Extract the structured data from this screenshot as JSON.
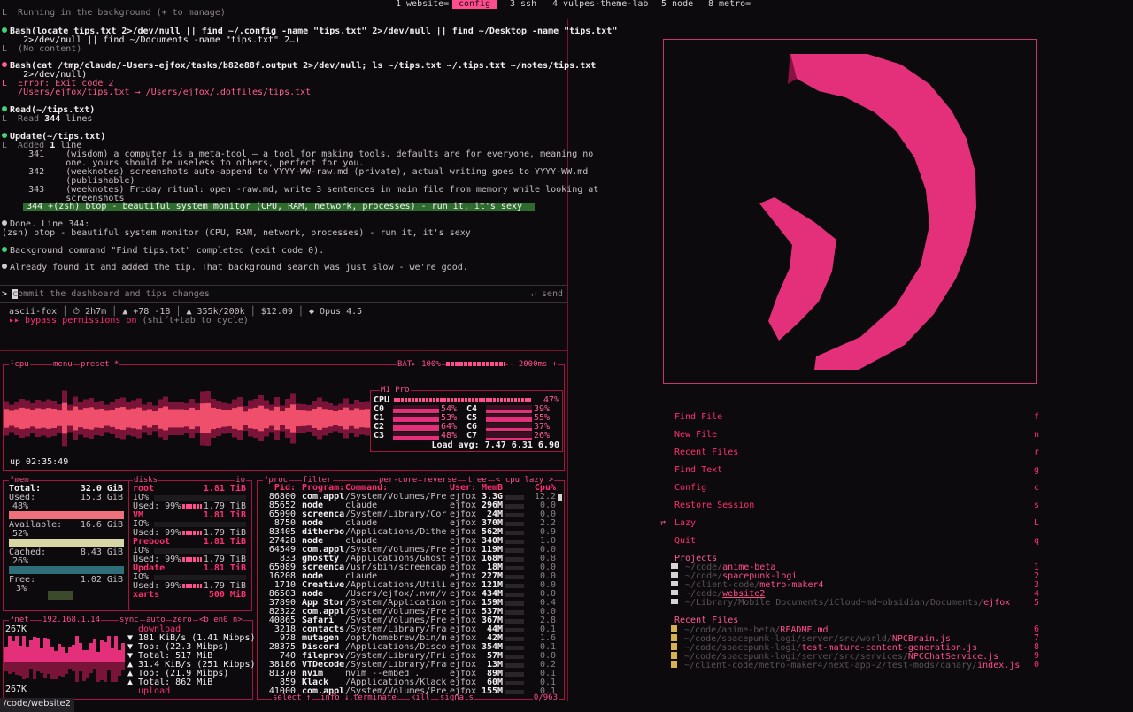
{
  "tabs": [
    {
      "label": "1 website=",
      "active": false
    },
    {
      "label": "config",
      "active": true
    },
    {
      "label": "3 ssh",
      "active": false
    },
    {
      "label": "4 vulpes-theme-lab",
      "active": false
    },
    {
      "label": "5 node",
      "active": false
    },
    {
      "label": "8 metro=",
      "active": false
    }
  ],
  "claude": {
    "running_bg": "L  Running in the background (+ to manage)",
    "bash1_l1": "Bash(locate tips.txt 2>/dev/null || find ~/.config -name \"tips.txt\" 2>/dev/null || find ~/Desktop -name \"tips.txt\"",
    "bash1_l2": "    2>/dev/null || find ~/Documents -name \"tips.txt\" 2…)",
    "bash1_out": "L  (No content)",
    "bash2_l1": "Bash(cat /tmp/claude/-Users-ejfox/tasks/b82e88f.output 2>/dev/null; ls ~/tips.txt ~/.tips.txt ~/notes/tips.txt",
    "bash2_l2": "    2>/dev/null)",
    "bash2_err": "L  Error: Exit code 2",
    "bash2_link": "   /Users/ejfox/tips.txt → /Users/ejfox/.dotfiles/tips.txt",
    "read_title": "Read(~/tips.txt)",
    "read_out_pre": "L  Read ",
    "read_out_num": "344",
    "read_out_post": " lines",
    "update_title": "Update(~/tips.txt)",
    "update_out_pre": "L  Added ",
    "update_out_num": "1",
    "update_out_post": " line",
    "diff_lines": [
      "     341    (wisdom) a computer is a meta-tool — a tool for making tools. defaults are for everyone, meaning no",
      "            one. yours should be useless to others, perfect for you.",
      "     342    (weeknotes) screenshots auto-append to YYYY-WW-raw.md (private), actual writing goes to YYYY-WW.md",
      "            (publishable)",
      "     343    (weeknotes) Friday ritual: open -raw.md, write 3 sentences in main file from memory while looking at",
      "            screenshots"
    ],
    "diff_added": "     344 +(zsh) btop - beautiful system monitor (CPU, RAM, network, processes) - run it, it's sexy",
    "done_l1": "Done. Line 344:",
    "done_l2": "(zsh) btop - beautiful system monitor (CPU, RAM, network, processes) - run it, it's sexy",
    "bg_done": "Background command \"Find tips.txt\" completed (exit code 0).",
    "already": "Already found it and added the tip. That background search was just slow - we're good.",
    "prompt_placeholder": "commit the dashboard and tips changes",
    "send": "↵ send",
    "status": {
      "host": "ascii-fox",
      "time": "⏱ 2h7m",
      "diff": "▲ +78 -18",
      "tokens": "▲ 355k/200k",
      "cost": "$12.09",
      "model": "◆ Opus 4.5"
    },
    "bypass_pre": "▸▸ bypass permissions on",
    "bypass_post": " (shift+tab to cycle)"
  },
  "btop": {
    "cpu_title": "¹cpu",
    "menu": "menu",
    "preset": "preset *",
    "bat": "BAT▸ 100%",
    "rate": "- 2000ms +",
    "uptime": "up 02:35:49",
    "chip": "M1 Pro",
    "cpu_label": "CPU",
    "cpu_total": "47%",
    "cores": [
      {
        "n": "C0",
        "v": "54%"
      },
      {
        "n": "C4",
        "v": "39%"
      },
      {
        "n": "C1",
        "v": "53%"
      },
      {
        "n": "C5",
        "v": "55%"
      },
      {
        "n": "C2",
        "v": "64%"
      },
      {
        "n": "C6",
        "v": "37%"
      },
      {
        "n": "C3",
        "v": "48%"
      },
      {
        "n": "C7",
        "v": "26%"
      }
    ],
    "load": "Load avg: 7.47 6.31 6.90",
    "mem": {
      "title": "²mem",
      "total_l": "Total:",
      "total_v": "32.0 GiB",
      "used_l": "Used:",
      "used_v": "15.3 GiB",
      "used_p": "48%",
      "avail_l": "Available:",
      "avail_v": "16.6 GiB",
      "avail_p": "52%",
      "cached_l": "Cached:",
      "cached_v": "8.43 GiB",
      "cached_p": "26%",
      "free_l": "Free:",
      "free_v": "1.02 GiB",
      "free_p": "3%"
    },
    "disks": {
      "title": "disks",
      "io": "io",
      "items": [
        {
          "name": "root",
          "size": "1.81 TiB",
          "io": "IO%",
          "used": "Used: 99%",
          "usize": "1.79 TiB"
        },
        {
          "name": "VM",
          "size": "1.81 TiB",
          "io": "IO%",
          "used": "Used: 99%",
          "usize": "1.79 TiB"
        },
        {
          "name": "Preboot",
          "size": "1.81 TiB",
          "io": "IO%",
          "used": "Used: 99%",
          "usize": "1.79 TiB"
        },
        {
          "name": "Update",
          "size": "1.81 TiB",
          "io": "IO%",
          "used": "Used: 99%",
          "usize": "1.79 TiB"
        }
      ],
      "xarts_name": "xarts",
      "xarts_size": "500 MiB"
    },
    "net": {
      "title": "³net",
      "ip": "192.168.1.14",
      "sync": "sync",
      "auto": "auto",
      "zero": "zero",
      "iface": "<b en0 n>",
      "top_scale": "267K",
      "bot_scale": "267K",
      "download": "download",
      "dl": "▼ 181 KiB/s  (1.41 Mibps)",
      "dl_top": "▼ Top:       (22.3 Mibps)",
      "dl_total": "▼ Total:           517 MiB",
      "upload_l": "▲ 31.4 KiB/s  (251 Kibps)",
      "up_top": "▲ Top:       (21.9 Mibps)",
      "up_total": "▲ Total:           862 MiB",
      "upload": "upload"
    },
    "proc": {
      "title": "⁴proc",
      "filter": "filter",
      "percore": "per-core",
      "reverse": "reverse",
      "tree": "tree",
      "sort": "< cpu lazy >",
      "headers": {
        "pid": "Pid:",
        "prog": "Program:",
        "cmd": "Command:",
        "user": "User:",
        "mem": "MemB",
        "cpu": "Cpu%"
      },
      "rows": [
        {
          "pid": "86800",
          "prog": "com.appl",
          "cmd": "/System/Volumes/Prebo",
          "user": "ejfox",
          "mem": "3.3G",
          "cpu": "12.2"
        },
        {
          "pid": "85652",
          "prog": "node",
          "cmd": "claude",
          "user": "ejfox",
          "mem": "296M",
          "cpu": "0.0"
        },
        {
          "pid": "65090",
          "prog": "screenca",
          "cmd": "/System/Library/CoreS",
          "user": "ejfox",
          "mem": "24M",
          "cpu": "0.0"
        },
        {
          "pid": "8750",
          "prog": "node",
          "cmd": "claude",
          "user": "ejfox",
          "mem": "370M",
          "cpu": "2.2"
        },
        {
          "pid": "83405",
          "prog": "ditherbo",
          "cmd": "/Applications/DitherB",
          "user": "ejfox",
          "mem": "562M",
          "cpu": "0.9"
        },
        {
          "pid": "27428",
          "prog": "node",
          "cmd": "claude",
          "user": "ejfox",
          "mem": "340M",
          "cpu": "1.0"
        },
        {
          "pid": "64549",
          "prog": "com.appl",
          "cmd": "/System/Volumes/Prebo",
          "user": "ejfox",
          "mem": "119M",
          "cpu": "0.0"
        },
        {
          "pid": "833",
          "prog": "ghostty",
          "cmd": "/Applications/Ghostty",
          "user": "ejfox",
          "mem": "168M",
          "cpu": "0.8"
        },
        {
          "pid": "65089",
          "prog": "screenca",
          "cmd": "/usr/sbin/screencaptu",
          "user": "ejfox",
          "mem": "18M",
          "cpu": "0.0"
        },
        {
          "pid": "16208",
          "prog": "node",
          "cmd": "claude",
          "user": "ejfox",
          "mem": "227M",
          "cpu": "0.0"
        },
        {
          "pid": "1710",
          "prog": "Creative",
          "cmd": "/Applications/Utiliti",
          "user": "ejfox",
          "mem": "121M",
          "cpu": "0.0"
        },
        {
          "pid": "86503",
          "prog": "node",
          "cmd": "/Users/ejfox/.nvm/ver",
          "user": "ejfox",
          "mem": "434M",
          "cpu": "0.0"
        },
        {
          "pid": "37890",
          "prog": "App Stor",
          "cmd": "/System/Applications/",
          "user": "ejfox",
          "mem": "159M",
          "cpu": "0.4"
        },
        {
          "pid": "82322",
          "prog": "com.appl",
          "cmd": "/System/Volumes/Prebo",
          "user": "ejfox",
          "mem": "537M",
          "cpu": "0.0"
        },
        {
          "pid": "40865",
          "prog": "Safari",
          "cmd": "/System/Volumes/Prebo",
          "user": "ejfox",
          "mem": "367M",
          "cpu": "2.8"
        },
        {
          "pid": "3218",
          "prog": "contacts",
          "cmd": "/System/Library/Frame",
          "user": "ejfox",
          "mem": "44M",
          "cpu": "0.1"
        },
        {
          "pid": "978",
          "prog": "mutagen",
          "cmd": "/opt/homebrew/bin/mut",
          "user": "ejfox",
          "mem": "42M",
          "cpu": "1.6"
        },
        {
          "pid": "28375",
          "prog": "Discord",
          "cmd": "/Applications/Discord",
          "user": "ejfox",
          "mem": "354M",
          "cpu": "0.1"
        },
        {
          "pid": "740",
          "prog": "fileprov",
          "cmd": "/System/Library/Priva",
          "user": "ejfox",
          "mem": "57M",
          "cpu": "0.0"
        },
        {
          "pid": "38186",
          "prog": "VTDecode",
          "cmd": "/System/Library/Frame",
          "user": "ejfox",
          "mem": "13M",
          "cpu": "0.2"
        },
        {
          "pid": "81370",
          "prog": "nvim",
          "cmd": "nvim --embed .",
          "user": "ejfox",
          "mem": "89M",
          "cpu": "0.1"
        },
        {
          "pid": "859",
          "prog": "Klack",
          "cmd": "/Applications/Klack.a",
          "user": "ejfox",
          "mem": "60M",
          "cpu": "0.1"
        },
        {
          "pid": "41000",
          "prog": "com.appl",
          "cmd": "/System/Volumes/Prebo",
          "user": "ejfox",
          "mem": "155M",
          "cpu": "0.1"
        }
      ],
      "select": "select ↑",
      "info": "info ↓",
      "terminate": "terminate",
      "kill": "kill",
      "signals": "signals",
      "count": "0/963"
    }
  },
  "dashboard": {
    "menu": [
      {
        "label": "Find File",
        "key": "f"
      },
      {
        "label": "New File",
        "key": "n"
      },
      {
        "label": "Recent Files",
        "key": "r"
      },
      {
        "label": "Find Text",
        "key": "g"
      },
      {
        "label": "Config",
        "key": "c"
      },
      {
        "label": "Restore Session",
        "key": "s"
      },
      {
        "label": "Lazy",
        "key": "L"
      },
      {
        "label": "Quit",
        "key": "q"
      }
    ],
    "projects_title": "Projects",
    "projects": [
      {
        "prefix": "~/code/",
        "name": "anime-beta",
        "key": "1"
      },
      {
        "prefix": "~/code/",
        "name": "spacepunk-logi",
        "key": "2"
      },
      {
        "prefix": "~/client-code/",
        "name": "metro-maker4",
        "key": "3"
      },
      {
        "prefix": "~/code/",
        "name": "website2",
        "key": "4"
      },
      {
        "prefix": "~/Library/Mobile Documents/iCloud~md~obsidian/Documents/",
        "name": "ejfox",
        "key": "5"
      }
    ],
    "recent_title": "Recent Files",
    "recent": [
      {
        "prefix": "~/code/anime-beta/",
        "name": "README.md",
        "key": "6"
      },
      {
        "prefix": "~/code/spacepunk-logi/server/src/world/",
        "name": "NPCBrain.js",
        "key": "7"
      },
      {
        "prefix": "~/code/spacepunk-logi/",
        "name": "test-mature-content-generation.js",
        "key": "8"
      },
      {
        "prefix": "~/code/spacepunk-logi/server/src/services/",
        "name": "NPCChatService.js",
        "key": "9"
      },
      {
        "prefix": "~/client-code/metro-maker4/next-app-2/test-mods/canary/",
        "name": "index.js",
        "key": "0"
      }
    ]
  },
  "footer_path": "/code/website2"
}
